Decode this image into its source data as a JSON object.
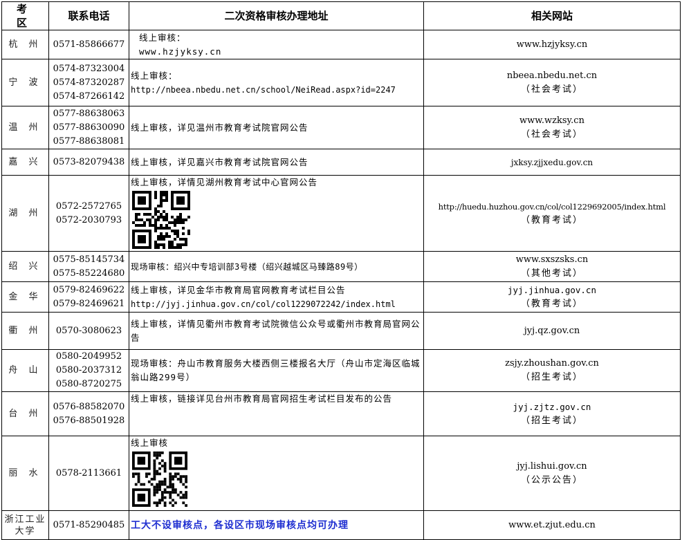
{
  "headers": {
    "region": "考 区",
    "phone": "联系电话",
    "address": "二次资格审核办理地址",
    "website": "相关网站"
  },
  "rows": [
    {
      "region": "杭 州",
      "phones": [
        "0571-85866677"
      ],
      "address": [
        "线上审核：",
        "www.hzjyksy.cn"
      ],
      "site": "www.hzjyksy.cn",
      "note": ""
    },
    {
      "region": "宁 波",
      "phones": [
        "0574-87323004",
        "0574-87320287",
        "0574-87266142"
      ],
      "address": [
        "线上审核：",
        "http://nbeea.nbedu.net.cn/school/NeiRead.aspx?id=2247"
      ],
      "site": "nbeea.nbedu.net.cn",
      "note": "（社会考试）"
    },
    {
      "region": "温 州",
      "phones": [
        "0577-88638063",
        "0577-88630090",
        "0577-88638081"
      ],
      "address": [
        "线上审核，详见温州市教育考试院官网公告"
      ],
      "site": "www.wzksy.cn",
      "note": "（社会考试）"
    },
    {
      "region": "嘉 兴",
      "phones": [
        "0573-82079438"
      ],
      "address": [
        "线上审核，详见嘉兴市教育考试院官网公告"
      ],
      "site": "jxksy.zjjxedu.gov.cn",
      "note": ""
    },
    {
      "region": "湖 州",
      "phones": [
        "0572-2572765",
        "0572-2030793"
      ],
      "address": [
        "线上审核，详情见湖州教育考试中心官网公告"
      ],
      "site": "http://huedu.huzhou.gov.cn/col/col1229692005/index.html",
      "note": "（教育考试）"
    },
    {
      "region": "绍 兴",
      "phones": [
        "0575-85145734",
        "0575-85224680"
      ],
      "address": [
        "现场审核：绍兴中专培训部3号楼（绍兴越城区马臻路89号）"
      ],
      "site": "www.sxszsks.cn",
      "note": "（其他考试）"
    },
    {
      "region": "金 华",
      "phones": [
        "0579-82469622",
        "0579-82469621"
      ],
      "address": [
        "线上审核，详见金华市教育局官网教育考试栏目公告",
        "http://jyj.jinhua.gov.cn/col/col1229072242/index.html"
      ],
      "site": "jyj.jinhua.gov.cn",
      "note": "（教育考试）"
    },
    {
      "region": "衢 州",
      "phones": [
        "0570-3080623"
      ],
      "address": [
        "线上审核，详情见衢州市教育考试院微信公众号或衢州市教育局官网公告"
      ],
      "site": "jyj.qz.gov.cn",
      "note": ""
    },
    {
      "region": "舟 山",
      "phones": [
        "0580-2049952",
        "0580-2037312",
        "0580-8720275"
      ],
      "address": [
        "现场审核：舟山市教育服务大楼西侧三楼报名大厅（舟山市定海区临城翁山路299号）"
      ],
      "site": "zsjy.zhoushan.gov.cn",
      "note": "（招生考试）"
    },
    {
      "region": "台 州",
      "phones": [
        "0576-88582070",
        "0576-88501928"
      ],
      "address": [
        "线上审核，链接详见台州市教育局官网招生考试栏目发布的公告"
      ],
      "site": "jyj.zjtz.gov.cn",
      "note": "（招生考试）"
    },
    {
      "region": "丽 水",
      "phones": [
        "0578-2113661"
      ],
      "address": [
        "线上审核"
      ],
      "site": "jyj.lishui.gov.cn",
      "note": "（公示公告）"
    },
    {
      "region": "浙江工业大学",
      "phones": [
        "0571-85290485"
      ],
      "address": [
        "工大不设审核点，各设区市现场审核点均可办理"
      ],
      "site": "www.et.zjut.edu.cn",
      "note": ""
    }
  ]
}
